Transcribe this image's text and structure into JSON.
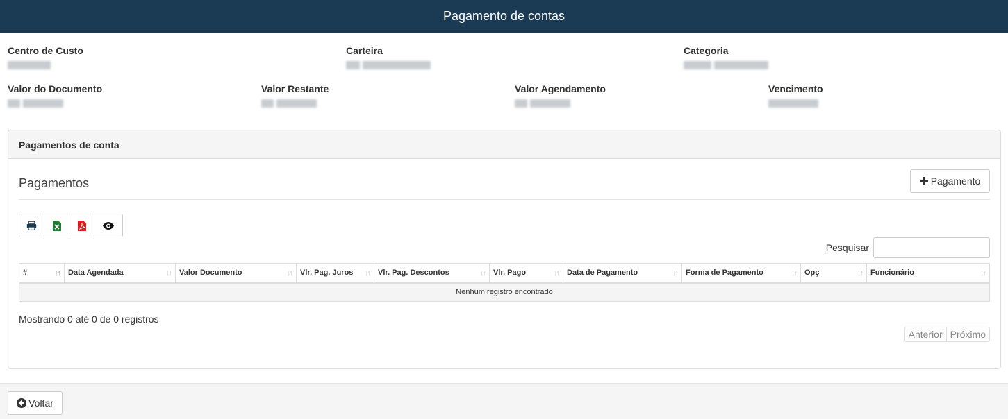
{
  "app": {
    "title": "Pagamento de contas"
  },
  "info": {
    "centro_custo_label": "Centro de Custo",
    "carteira_label": "Carteira",
    "categoria_label": "Categoria",
    "valor_documento_label": "Valor do Documento",
    "valor_restante_label": "Valor Restante",
    "valor_agendamento_label": "Valor Agendamento",
    "vencimento_label": "Vencimento"
  },
  "panel": {
    "heading": "Pagamentos de conta",
    "section_title": "Pagamentos",
    "add_button_label": "Pagamento",
    "search_label": "Pesquisar",
    "search_value": "",
    "table": {
      "columns": [
        "#",
        "Data Agendada",
        "Valor Documento",
        "Vlr. Pag. Juros",
        "Vlr. Pag. Descontos",
        "Vlr. Pago",
        "Data de Pagamento",
        "Forma de Pagamento",
        "Opç",
        "Funcionário"
      ],
      "empty_message": "Nenhum registro encontrado"
    },
    "info_text": "Mostrando 0 até 0 de 0 registros",
    "pager": {
      "previous": "Anterior",
      "next": "Próximo"
    }
  },
  "toolbar": {
    "icons": [
      "print-icon",
      "excel-icon",
      "pdf-icon",
      "eye-icon"
    ],
    "colors": {
      "print": "#1b3a53",
      "excel": "#1e7d32",
      "pdf": "#e02020",
      "eye": "#111111"
    }
  },
  "footer": {
    "back_label": "Voltar"
  },
  "colors": {
    "header_bg": "#1b3a53",
    "header_text": "#ffffff"
  }
}
